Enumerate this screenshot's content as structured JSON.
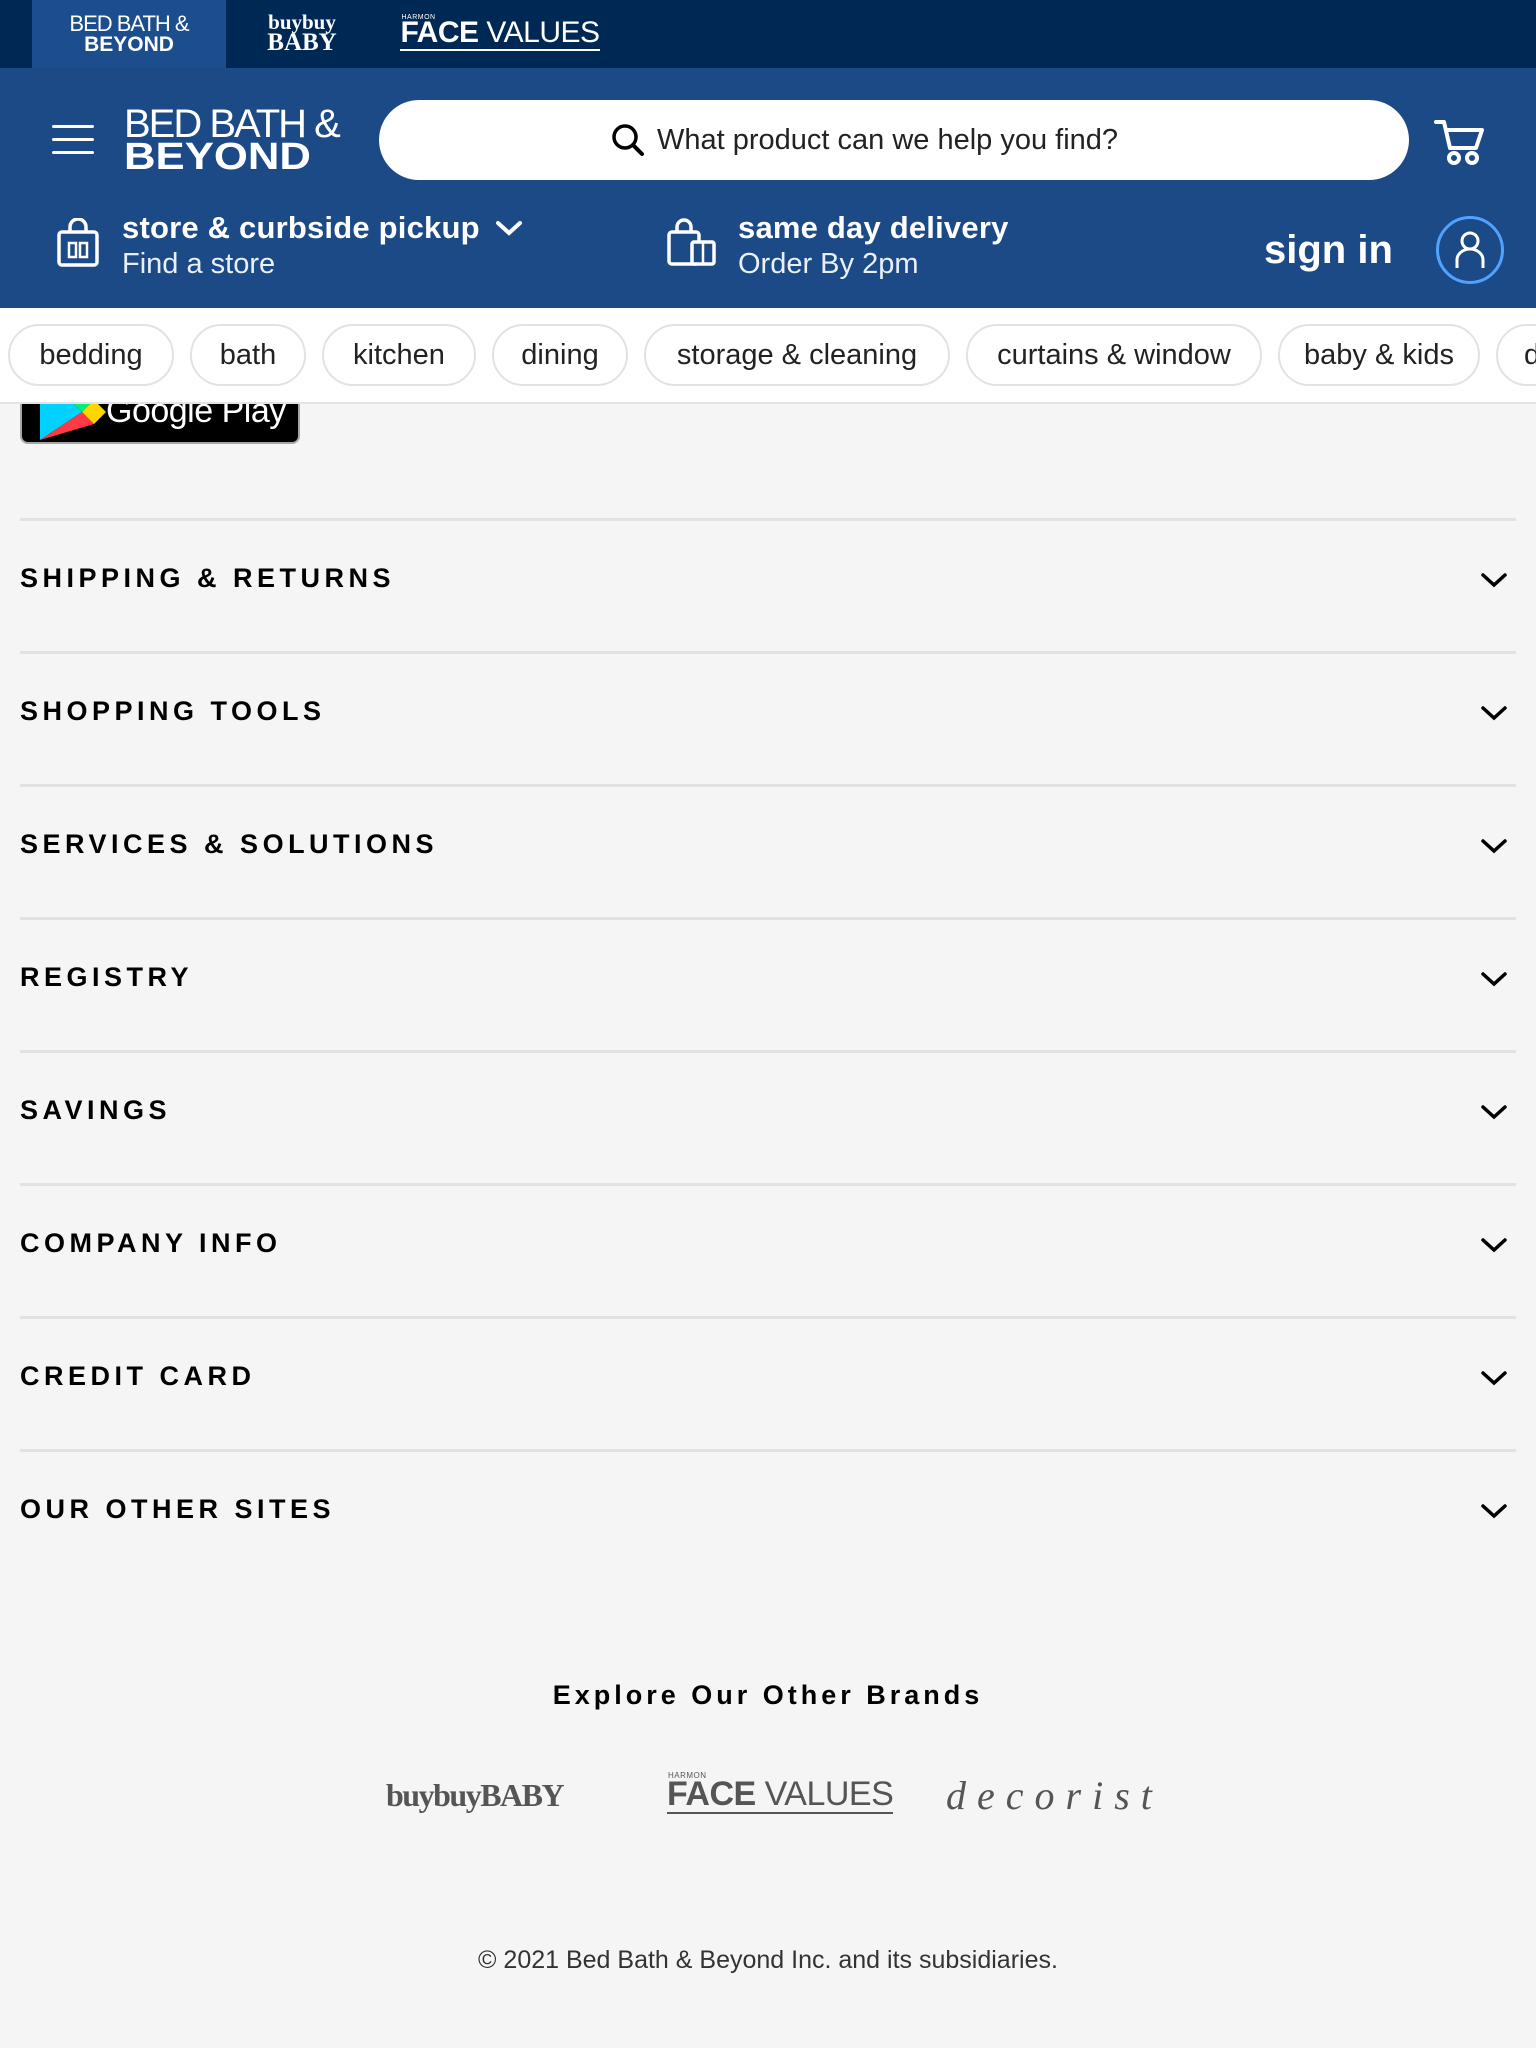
{
  "brand_strip": {
    "bbb": {
      "line1": "BED BATH &",
      "line2": "BEYOND"
    },
    "baby": {
      "line1": "buybuy",
      "line2": "BABY"
    },
    "facevalues": {
      "harmon": "HARMON",
      "face": "FACE",
      "values": " VALUES"
    }
  },
  "header": {
    "logo": {
      "line1": "BED BATH &",
      "line2": "BEYOND"
    },
    "search_placeholder": "What product can we help you find?",
    "store_title": "store & curbside pickup",
    "store_sub": "Find a store",
    "delivery_title": "same day delivery",
    "delivery_sub": "Order By 2pm",
    "signin": "sign in"
  },
  "categories": [
    "bedding",
    "bath",
    "kitchen",
    "dining",
    "storage & cleaning",
    "curtains & window",
    "baby & kids",
    "decor"
  ],
  "app_badge": {
    "label": "Google Play"
  },
  "accordion": [
    "SHIPPING & RETURNS",
    "SHOPPING TOOLS",
    "SERVICES & SOLUTIONS",
    "REGISTRY",
    "SAVINGS",
    "COMPANY INFO",
    "CREDIT CARD",
    "OUR OTHER SITES"
  ],
  "brands": {
    "title": "Explore Our Other Brands",
    "buybuybaby": "buybuyBABY",
    "facevalues": {
      "harmon": "HARMON",
      "face": "FACE",
      "values": " VALUES"
    },
    "decorist": "decorist"
  },
  "copyright": "© 2021 Bed Bath & Beyond Inc. and its subsidiaries.",
  "colors": {
    "brand_strip_bg": "#002855",
    "header_bg": "#1b4a87",
    "active_tab": "#1c4e8d",
    "account_ring": "#4fa3ff",
    "page_bg": "#f5f5f5"
  }
}
